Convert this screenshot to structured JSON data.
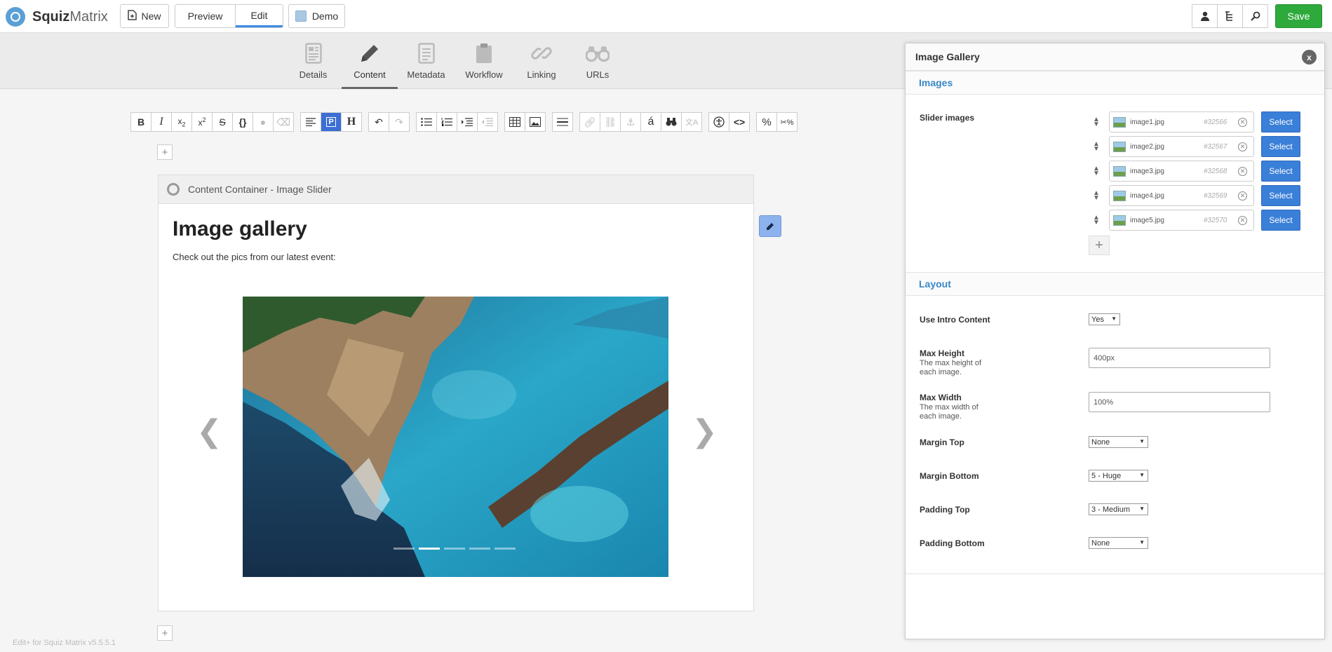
{
  "app": {
    "brand_bold": "Squiz",
    "brand_light": "Matrix",
    "new_label": "New",
    "preview_label": "Preview",
    "edit_label": "Edit",
    "demo_label": "Demo",
    "save_label": "Save",
    "footer": "Edit+ for Squiz Matrix v5.5.5.1"
  },
  "tabs": [
    {
      "label": "Details",
      "icon": "document-icon"
    },
    {
      "label": "Content",
      "icon": "pencil-icon"
    },
    {
      "label": "Metadata",
      "icon": "list-document-icon"
    },
    {
      "label": "Workflow",
      "icon": "clipboard-icon"
    },
    {
      "label": "Linking",
      "icon": "link-icon"
    },
    {
      "label": "URLs",
      "icon": "binoculars-icon"
    }
  ],
  "container": {
    "title": "Content Container - Image Slider",
    "heading": "Image gallery",
    "intro": "Check out the pics from our latest event:",
    "prev_arrow": "❮",
    "next_arrow": "❯",
    "slide_count": 5,
    "active_slide": 2
  },
  "panel": {
    "title": "Image Gallery",
    "close": "x",
    "images_section": "Images",
    "slider_images_label": "Slider images",
    "images": [
      {
        "name": "image1.jpg",
        "id": "#32566"
      },
      {
        "name": "image2.jpg",
        "id": "#32567"
      },
      {
        "name": "image3.jpg",
        "id": "#32568"
      },
      {
        "name": "image4.jpg",
        "id": "#32569"
      },
      {
        "name": "image5.jpg",
        "id": "#32570"
      }
    ],
    "select_label": "Select",
    "add_label": "+",
    "layout_section": "Layout",
    "use_intro_label": "Use Intro Content",
    "use_intro_value": "Yes",
    "max_height_label": "Max Height",
    "max_height_hint": "The max height of each image.",
    "max_height_value": "400px",
    "max_width_label": "Max Width",
    "max_width_hint": "The max width of each image.",
    "max_width_value": "100%",
    "margin_top_label": "Margin Top",
    "margin_top_value": "None",
    "margin_bottom_label": "Margin Bottom",
    "margin_bottom_value": "5 - Huge",
    "padding_top_label": "Padding Top",
    "padding_top_value": "3 - Medium",
    "padding_bottom_label": "Padding Bottom",
    "padding_bottom_value": "None"
  },
  "colors": {
    "accent_blue": "#3a87c8",
    "save_green": "#2eaa3d",
    "select_blue": "#3a7fd8"
  }
}
